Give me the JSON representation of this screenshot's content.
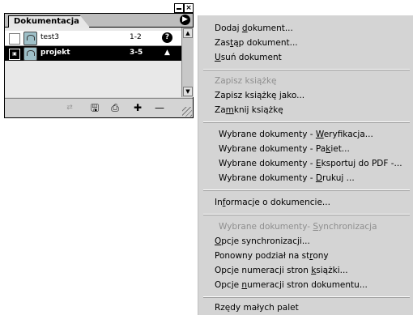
{
  "panel": {
    "tab_label": "Dokumentacja",
    "menu_button_icon": "panel-menu-arrow-icon",
    "documents": [
      {
        "name": "test3",
        "pages": "1-2",
        "status_icon": "question-icon",
        "status_glyph": "?",
        "selected": false
      },
      {
        "name": "projekt",
        "pages": "3-5",
        "status_icon": "book-source-icon",
        "status_glyph": "▲",
        "selected": true
      }
    ],
    "toolbar_icons": [
      "sync-icon",
      "save-icon",
      "print-icon",
      "add-icon",
      "remove-icon"
    ]
  },
  "menu": {
    "items": [
      {
        "pre": "Dodaj ",
        "u": "d",
        "post": "okument...",
        "disabled": false
      },
      {
        "pre": "Zas",
        "u": "t",
        "post": "ąp dokument...",
        "disabled": false
      },
      {
        "pre": "",
        "u": "U",
        "post": "suń dokument",
        "disabled": false
      },
      {
        "pre": "Zapisz książkę",
        "u": "",
        "post": "",
        "disabled": true
      },
      {
        "pre": "Zapisz książkę jako...",
        "u": "",
        "post": "",
        "disabled": false
      },
      {
        "pre": "Za",
        "u": "m",
        "post": "knij książkę",
        "disabled": false
      },
      {
        "pre": "Wybrane dokumenty - ",
        "u": "W",
        "post": "eryfikacja...",
        "disabled": false
      },
      {
        "pre": "Wybrane dokumenty - Pa",
        "u": "k",
        "post": "iet...",
        "disabled": false
      },
      {
        "pre": "Wybrane dokumenty - ",
        "u": "E",
        "post": "ksportuj do PDF -...",
        "disabled": false
      },
      {
        "pre": "Wybrane dokumenty - ",
        "u": "D",
        "post": "rukuj ...",
        "disabled": false
      },
      {
        "pre": "In",
        "u": "f",
        "post": "ormacje o dokumencie...",
        "disabled": false
      },
      {
        "pre": "Wybrane dokumenty- ",
        "u": "S",
        "post": "ynchronizacja",
        "disabled": true
      },
      {
        "pre": "",
        "u": "O",
        "post": "pcje synchronizacji...",
        "disabled": false
      },
      {
        "pre": "Ponowny podział na st",
        "u": "r",
        "post": "ony",
        "disabled": false
      },
      {
        "pre": "Opcje numeracji stron ",
        "u": "k",
        "post": "siążki...",
        "disabled": false
      },
      {
        "pre": "Opcje ",
        "u": "n",
        "post": "umeracji stron dokumentu...",
        "disabled": false
      },
      {
        "pre": "Rzędy małych palet",
        "u": "",
        "post": "",
        "disabled": false
      }
    ]
  }
}
